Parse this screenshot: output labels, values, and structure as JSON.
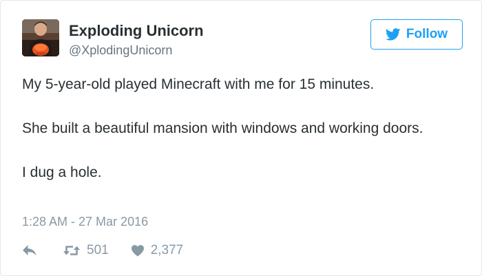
{
  "tweet": {
    "author_name": "Exploding Unicorn",
    "author_handle": "@XplodingUnicorn",
    "follow_label": "Follow",
    "paragraphs": [
      "My 5-year-old played Minecraft with me for 15 minutes.",
      "She built a beautiful mansion with windows and working doors.",
      "I dug a hole."
    ],
    "timestamp": "1:28 AM - 27 Mar 2016",
    "retweet_count": "501",
    "like_count": "2,377"
  },
  "icons": {
    "follow": "twitter-bird-icon",
    "reply": "reply-arrow-icon",
    "retweet": "retweet-icon",
    "like": "heart-icon"
  },
  "colors": {
    "accent": "#1da1f2",
    "text": "#292f33",
    "secondary": "#66757f",
    "meta": "#8899a6",
    "border": "#e1e8ed"
  }
}
